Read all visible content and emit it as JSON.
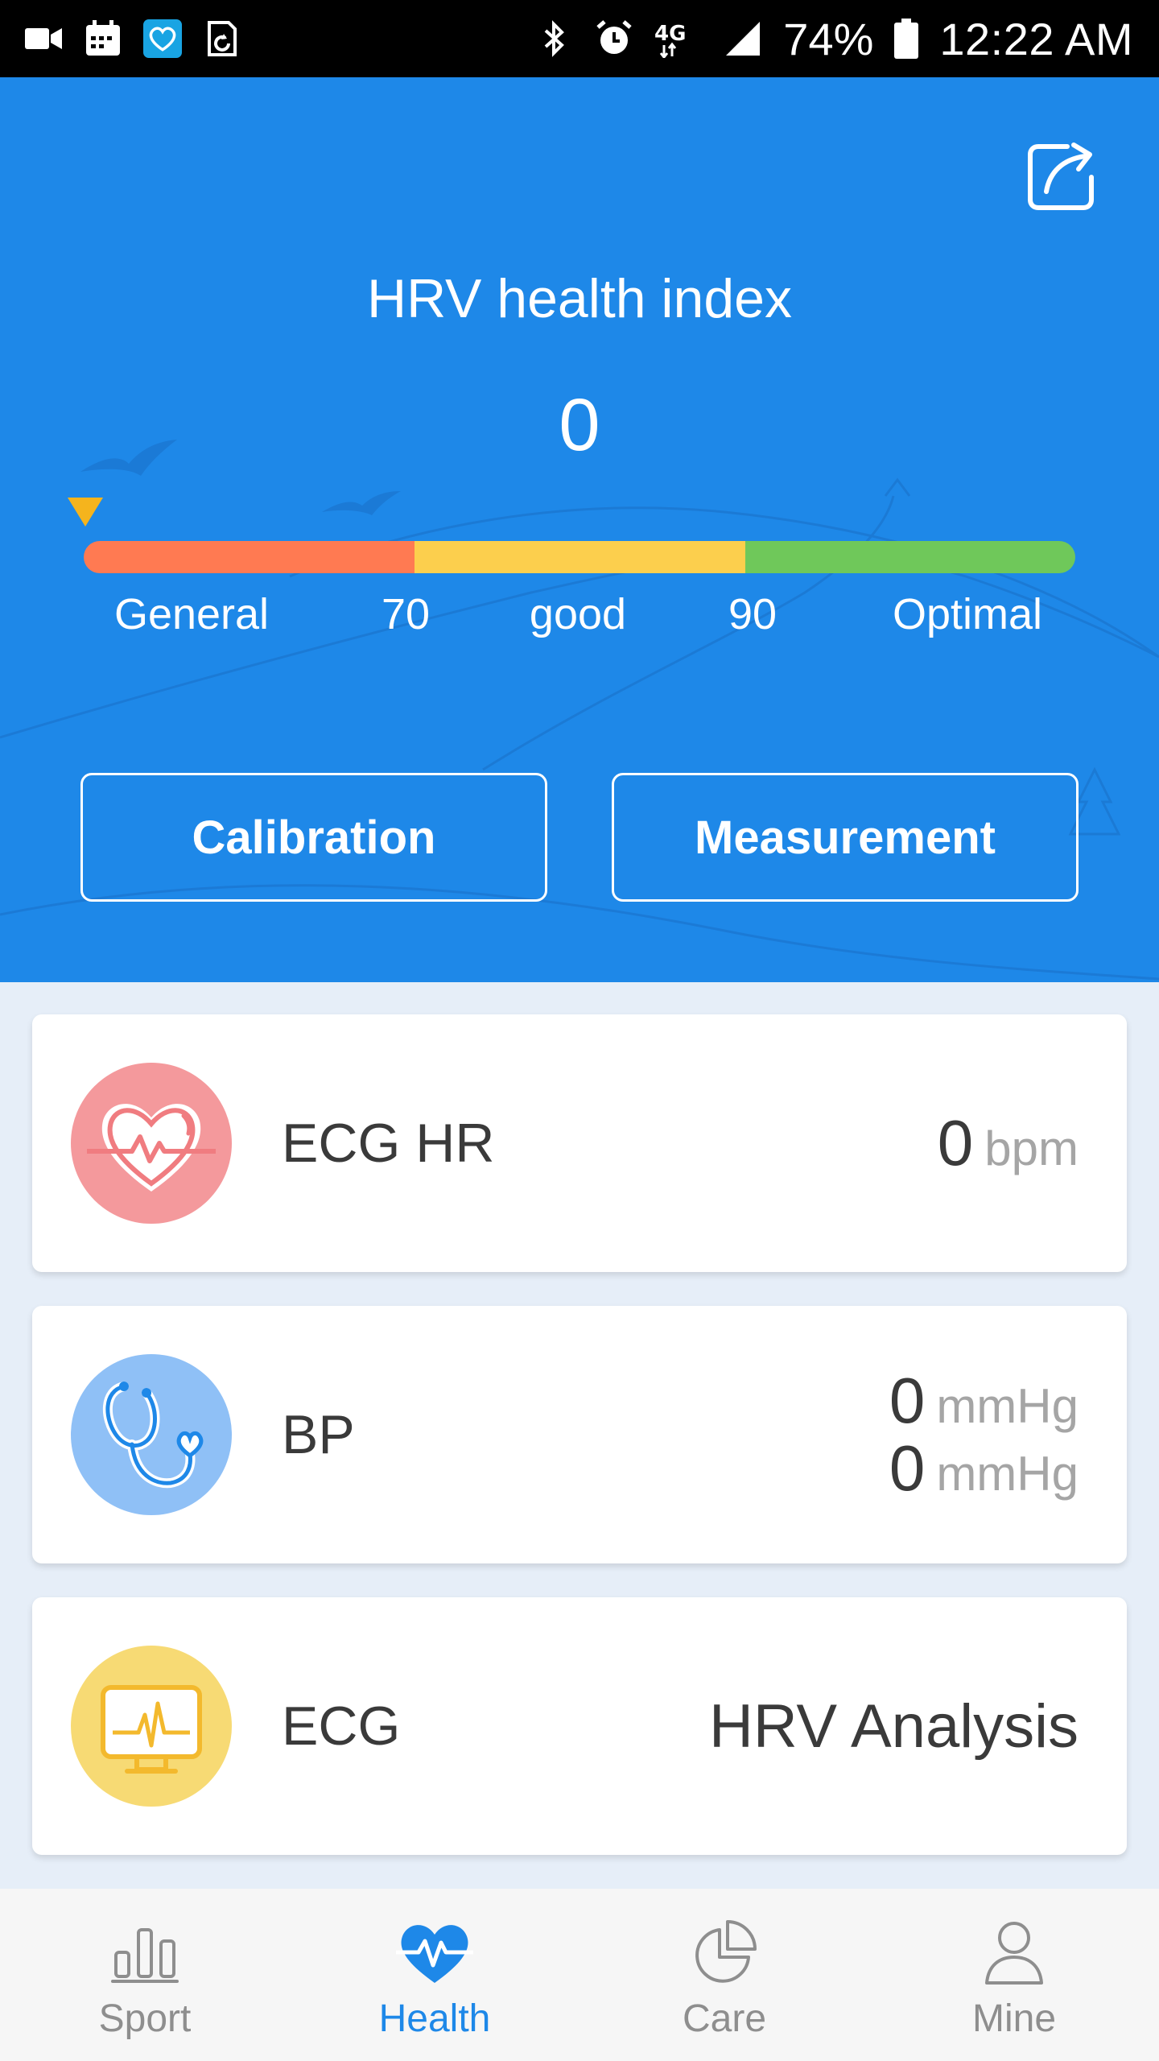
{
  "status_bar": {
    "battery": "74%",
    "time": "12:22 AM",
    "network": "4G",
    "icons_left": [
      "video-icon",
      "calendar-icon",
      "heart-app-icon",
      "sync-icon"
    ],
    "icons_right": [
      "bluetooth-icon",
      "alarm-icon",
      "network-4g-icon",
      "signal-icon",
      "battery-icon"
    ]
  },
  "hero": {
    "title": "HRV health index",
    "value": "0",
    "gauge": {
      "current_value": 0,
      "segments": [
        {
          "color": "#ff7a52"
        },
        {
          "color": "#fccf4d"
        },
        {
          "color": "#6fc85a"
        }
      ],
      "labels": [
        "General",
        "70",
        "good",
        "90",
        "Optimal"
      ],
      "marker_color": "#f5b41d"
    },
    "buttons": {
      "calibration": "Calibration",
      "measurement": "Measurement"
    },
    "colors": {
      "background": "#1e88e8"
    }
  },
  "cards": {
    "ecg_hr": {
      "label": "ECG HR",
      "value": "0",
      "unit": "bpm",
      "icon": "heart-pulse-icon",
      "icon_color": "#f4999c"
    },
    "bp": {
      "label": "BP",
      "systolic": "0",
      "diastolic": "0",
      "unit": "mmHg",
      "icon": "stethoscope-icon",
      "icon_color": "#8fc0f6"
    },
    "ecg": {
      "label": "ECG",
      "link": "HRV Analysis",
      "icon": "ecg-monitor-icon",
      "icon_color": "#f7da74"
    }
  },
  "bottom_nav": {
    "items": [
      {
        "label": "Sport",
        "icon": "bar-chart-icon",
        "active": false
      },
      {
        "label": "Health",
        "icon": "heart-pulse-icon",
        "active": true
      },
      {
        "label": "Care",
        "icon": "pie-chart-icon",
        "active": false
      },
      {
        "label": "Mine",
        "icon": "person-icon",
        "active": false
      }
    ],
    "active_color": "#1e88e8",
    "inactive_color": "#8e8e8e"
  }
}
